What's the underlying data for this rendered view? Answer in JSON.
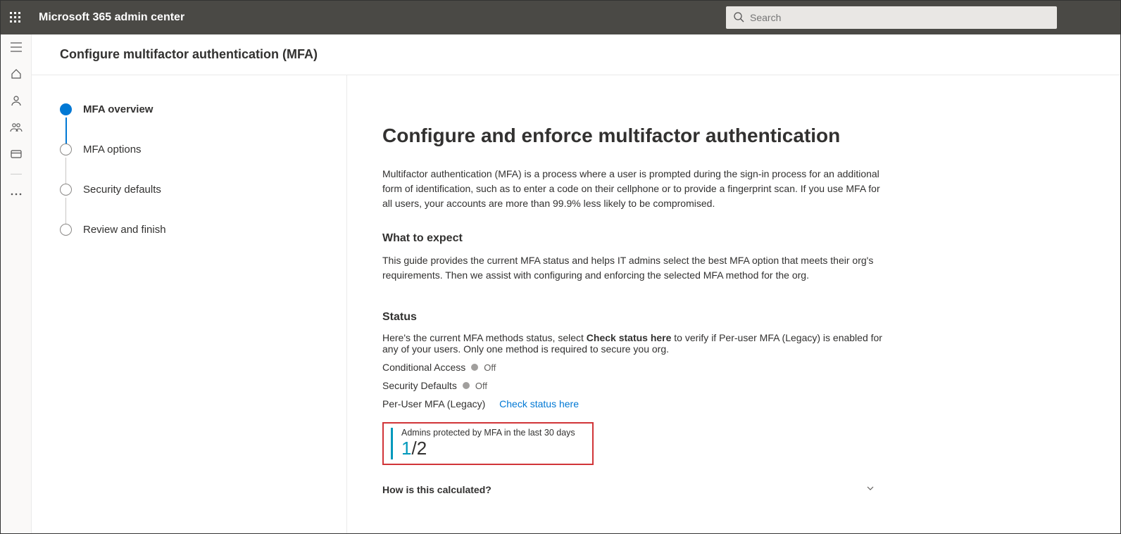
{
  "header": {
    "app_title": "Microsoft 365 admin center",
    "search_placeholder": "Search"
  },
  "page": {
    "title": "Configure multifactor authentication (MFA)"
  },
  "steps": [
    {
      "label": "MFA overview",
      "active": true
    },
    {
      "label": "MFA options",
      "active": false
    },
    {
      "label": "Security defaults",
      "active": false
    },
    {
      "label": "Review and finish",
      "active": false
    }
  ],
  "content": {
    "heading": "Configure and enforce multifactor authentication",
    "intro": "Multifactor authentication (MFA) is a process where a user is prompted during the sign-in process for an additional form of identification, such as to enter a code on their cellphone or to provide a fingerprint scan. If you use MFA for all users, your accounts are more than 99.9% less likely to be compromised.",
    "expect_heading": "What to expect",
    "expect_body": "This guide provides the current MFA status and helps IT admins select the best MFA option that meets their org's requirements. Then we assist with configuring and enforcing the selected MFA method for the org.",
    "status_heading": "Status",
    "status_intro_pre": "Here's the current MFA methods status, select ",
    "status_intro_bold": "Check status here",
    "status_intro_post": " to verify if Per-user MFA (Legacy) is enabled for any of your users. Only one method is required to secure you org.",
    "rows": {
      "conditional_access": {
        "label": "Conditional Access",
        "state": "Off"
      },
      "security_defaults": {
        "label": "Security Defaults",
        "state": "Off"
      },
      "per_user_mfa": {
        "label": "Per-User MFA (Legacy)",
        "link": "Check status here"
      }
    },
    "stat": {
      "label": "Admins protected by MFA in the last 30 days",
      "numerator": "1",
      "denominator": "2"
    },
    "accordion_label": "How is this calculated?"
  }
}
